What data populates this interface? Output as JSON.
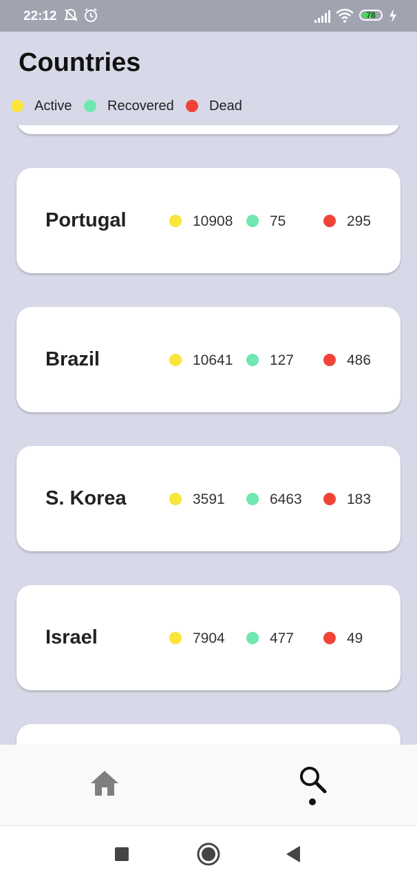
{
  "status_bar": {
    "time": "22:12",
    "battery_level": "78",
    "icons": [
      "mute-icon",
      "alarm-icon",
      "signal-icon",
      "wifi-icon",
      "battery-icon",
      "charging-icon"
    ]
  },
  "header": {
    "title": "Countries"
  },
  "legend": [
    {
      "label": "Active",
      "color": "#fbe53a"
    },
    {
      "label": "Recovered",
      "color": "#6ee7b0"
    },
    {
      "label": "Dead",
      "color": "#f04438"
    }
  ],
  "countries": [
    {
      "name": "Portugal",
      "active": "10908",
      "recovered": "75",
      "dead": "295"
    },
    {
      "name": "Brazil",
      "active": "10641",
      "recovered": "127",
      "dead": "486"
    },
    {
      "name": "S. Korea",
      "active": "3591",
      "recovered": "6463",
      "dead": "183"
    },
    {
      "name": "Israel",
      "active": "7904",
      "recovered": "477",
      "dead": "49"
    }
  ],
  "bottom_nav": {
    "items": [
      {
        "icon": "home-icon",
        "selected": false
      },
      {
        "icon": "search-icon",
        "selected": true
      }
    ]
  },
  "system_nav": {
    "icons": [
      "recents-icon",
      "home-circle-icon",
      "back-icon"
    ]
  },
  "colors": {
    "background": "#d8d9e8",
    "card": "#ffffff",
    "status_bar": "#a2a3b1"
  }
}
